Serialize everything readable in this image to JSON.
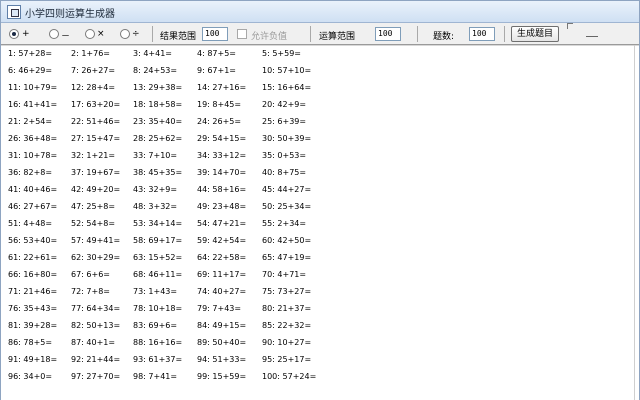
{
  "window": {
    "title": "小学四则运算生成器"
  },
  "toolbar": {
    "ops": [
      "+",
      "－",
      "×",
      "÷"
    ],
    "result_range_label": "结果范围",
    "result_range_value": "100",
    "allow_negative_label": "允许负值",
    "calc_range_label": "运算范围",
    "calc_range_value": "100",
    "count_label": "题数:",
    "count_value": "100",
    "generate_button": "生成题目"
  },
  "questions": [
    "1: 57+28=",
    "2: 1+76=",
    "3: 4+41=",
    "4: 87+5=",
    "5: 5+59=",
    "6: 46+29=",
    "7: 26+27=",
    "8: 24+53=",
    "9: 67+1=",
    "10: 57+10=",
    "11: 10+79=",
    "12: 28+4=",
    "13: 29+38=",
    "14: 27+16=",
    "15: 16+64=",
    "16: 41+41=",
    "17: 63+20=",
    "18: 18+58=",
    "19: 8+45=",
    "20: 42+9=",
    "21: 2+54=",
    "22: 51+46=",
    "23: 35+40=",
    "24: 26+5=",
    "25: 6+39=",
    "26: 36+48=",
    "27: 15+47=",
    "28: 25+62=",
    "29: 54+15=",
    "30: 50+39=",
    "31: 10+78=",
    "32: 1+21=",
    "33: 7+10=",
    "34: 33+12=",
    "35: 0+53=",
    "36: 82+8=",
    "37: 19+67=",
    "38: 45+35=",
    "39: 14+70=",
    "40: 8+75=",
    "41: 40+46=",
    "42: 49+20=",
    "43: 32+9=",
    "44: 58+16=",
    "45: 44+27=",
    "46: 27+67=",
    "47: 25+8=",
    "48: 3+32=",
    "49: 23+48=",
    "50: 25+34=",
    "51: 4+48=",
    "52: 54+8=",
    "53: 34+14=",
    "54: 47+21=",
    "55: 2+34=",
    "56: 53+40=",
    "57: 49+41=",
    "58: 69+17=",
    "59: 42+54=",
    "60: 42+50=",
    "61: 22+61=",
    "62: 30+29=",
    "63: 15+52=",
    "64: 22+58=",
    "65: 47+19=",
    "66: 16+80=",
    "67: 6+6=",
    "68: 46+11=",
    "69: 11+17=",
    "70: 4+71=",
    "71: 21+46=",
    "72: 7+8=",
    "73: 1+43=",
    "74: 40+27=",
    "75: 73+27=",
    "76: 35+43=",
    "77: 64+34=",
    "78: 10+18=",
    "79: 7+43=",
    "80: 21+37=",
    "81: 39+28=",
    "82: 50+13=",
    "83: 69+6=",
    "84: 49+15=",
    "85: 22+32=",
    "86: 78+5=",
    "87: 40+1=",
    "88: 16+16=",
    "89: 50+40=",
    "90: 10+27=",
    "91: 49+18=",
    "92: 21+44=",
    "93: 61+37=",
    "94: 51+33=",
    "95: 25+17=",
    "96: 34+0=",
    "97: 27+70=",
    "98: 7+41=",
    "99: 15+59=",
    "100: 57+24="
  ]
}
